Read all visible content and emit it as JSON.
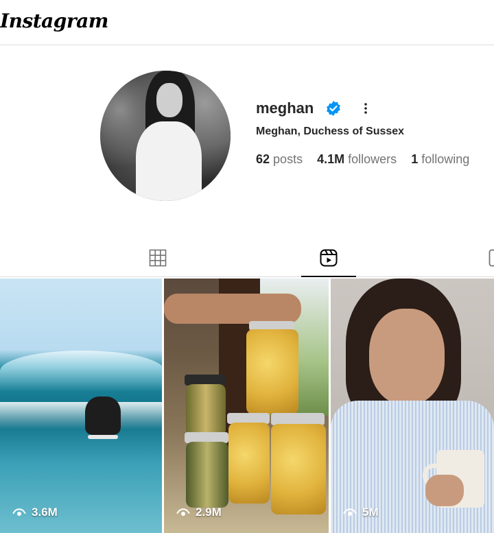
{
  "app": {
    "title": "Instagram"
  },
  "profile": {
    "username": "meghan",
    "full_name": "Meghan, Duchess of Sussex",
    "stats": {
      "posts": {
        "value": "62",
        "label": "posts"
      },
      "followers": {
        "value": "4.1M",
        "label": "followers"
      },
      "following": {
        "value": "1",
        "label": "following"
      }
    }
  },
  "icons": {
    "verified": "verified-badge-icon",
    "more": "more-options-icon",
    "grid_tab": "grid-icon",
    "reels_tab": "reels-icon",
    "tagged_tab": "tagged-icon",
    "views": "eye-icon"
  },
  "colors": {
    "verified": "#0095f6",
    "text": "#262626",
    "muted": "#737373",
    "divider": "#dbdbdb"
  },
  "reels": [
    {
      "views": "3.6M"
    },
    {
      "views": "2.9M"
    },
    {
      "views": "5M"
    }
  ]
}
